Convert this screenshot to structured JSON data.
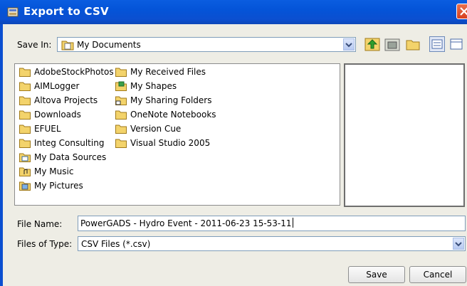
{
  "window": {
    "title": "Export to CSV"
  },
  "save_in": {
    "label": "Save In:",
    "value": "My Documents"
  },
  "files": [
    {
      "name": "AdobeStockPhotos",
      "icon": "folder-icon"
    },
    {
      "name": "AIMLogger",
      "icon": "folder-icon"
    },
    {
      "name": "Altova Projects",
      "icon": "folder-icon"
    },
    {
      "name": "Downloads",
      "icon": "folder-icon"
    },
    {
      "name": "EFUEL",
      "icon": "folder-icon"
    },
    {
      "name": "Integ Consulting",
      "icon": "folder-icon"
    },
    {
      "name": "My Data Sources",
      "icon": "data-sources-folder-icon"
    },
    {
      "name": "My Music",
      "icon": "music-folder-icon"
    },
    {
      "name": "My Pictures",
      "icon": "pictures-folder-icon"
    },
    {
      "name": "My Received Files",
      "icon": "folder-icon"
    },
    {
      "name": "My Shapes",
      "icon": "shapes-folder-icon"
    },
    {
      "name": "My Sharing Folders",
      "icon": "sharing-folder-icon"
    },
    {
      "name": "OneNote Notebooks",
      "icon": "folder-icon"
    },
    {
      "name": "Version Cue",
      "icon": "folder-icon"
    },
    {
      "name": "Visual Studio 2005",
      "icon": "folder-icon"
    }
  ],
  "file_name": {
    "label": "File Name:",
    "value": "PowerGADS - Hydro Event - 2011-06-23 15-53-11"
  },
  "file_type": {
    "label": "Files of Type:",
    "value": "CSV Files (*.csv)"
  },
  "buttons": {
    "save": "Save",
    "cancel": "Cancel"
  },
  "colors": {
    "title_bar": "#0454d8",
    "close_button": "#d6401f",
    "folder": "#f3d36b"
  }
}
